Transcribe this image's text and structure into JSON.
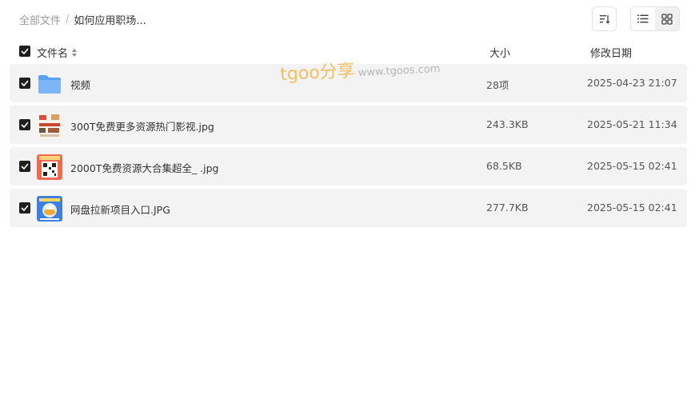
{
  "breadcrumb": {
    "root": "全部文件",
    "separator": "/",
    "current": "如何应用职场..."
  },
  "toolbar": {
    "sort_icon": "sort-icon",
    "list_view_icon": "list-view-icon",
    "grid_view_icon": "grid-view-icon",
    "active_view": "list"
  },
  "table": {
    "headers": {
      "name": "文件名",
      "size": "大小",
      "date": "修改日期"
    },
    "rows": [
      {
        "type": "folder",
        "icon": "folder-icon",
        "name": "视频",
        "size": "28项",
        "date": "2025-04-23 21:07",
        "checked": true
      },
      {
        "type": "image",
        "icon": "image-thumbnail",
        "name": "300T免费更多资源热门影视.jpg",
        "size": "243.3KB",
        "date": "2025-05-21 11:34",
        "checked": true
      },
      {
        "type": "image",
        "icon": "image-thumbnail",
        "name": "2000T免费资源大合集超全_ .jpg",
        "size": "68.5KB",
        "date": "2025-05-15 02:41",
        "checked": true
      },
      {
        "type": "image",
        "icon": "image-thumbnail",
        "name": "网盘拉新项目入口.JPG",
        "size": "277.7KB",
        "date": "2025-05-15 02:41",
        "checked": true
      }
    ]
  },
  "watermark": {
    "brand": "tgoo分享",
    "url": "www.tgoos.com"
  },
  "colors": {
    "row_background": "#f3f3f3",
    "checkbox": "#1f1f1f",
    "folder": "#6aa9f2",
    "watermark": "#f0b74a"
  }
}
